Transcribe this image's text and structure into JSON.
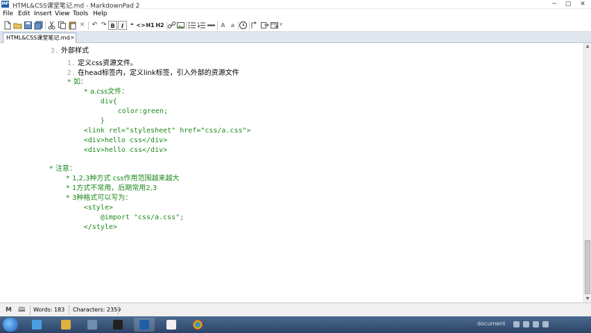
{
  "window": {
    "app_icon_text": "MP",
    "title": "HTML&CSS课堂笔记.md - MarkdownPad 2",
    "min_glyph": "─",
    "max_glyph": "▢",
    "close_glyph": "✕"
  },
  "menu": {
    "items": [
      "File",
      "Edit",
      "Insert",
      "View",
      "Tools",
      "Help"
    ]
  },
  "toolbar": {
    "bold": "B",
    "italic": "I",
    "quote": "❝",
    "code": "<>",
    "h1": "H1",
    "h2": "H2",
    "upper_a": "A",
    "lower_a": "a"
  },
  "tab": {
    "label": "HTML&CSS课堂笔记.md",
    "close": "✕"
  },
  "editor": {
    "lines": [
      {
        "marker": "3.",
        "text": "外部样式",
        "cls": "dark cjk"
      },
      {
        "marker": "1.",
        "text": "定义css资源文件。",
        "cls": "dark cjk"
      },
      {
        "marker": "2.",
        "text": "在head标签内，定义link标签，引入外部的资源文件",
        "cls": "dark cjk"
      },
      {
        "marker": "*",
        "text": "如：",
        "cls": "green cjk"
      },
      {
        "marker": "*",
        "text": "a.css文件：",
        "cls": "green cjk"
      },
      {
        "marker": "",
        "text": "div{",
        "cls": "green mono"
      },
      {
        "marker": "",
        "text": "color:green;",
        "cls": "green mono"
      },
      {
        "marker": "",
        "text": "}",
        "cls": "green mono"
      },
      {
        "marker": "",
        "text": "<link rel=\"stylesheet\" href=\"css/a.css\">",
        "cls": "green mono"
      },
      {
        "marker": "",
        "text": "<div>hello css</div>",
        "cls": "green mono"
      },
      {
        "marker": "",
        "text": "<div>hello css</div>",
        "cls": "green mono"
      },
      {
        "marker": "*",
        "text": "注意：",
        "cls": "green cjk"
      },
      {
        "marker": "*",
        "text": "1,2,3种方式 css作用范围越来越大",
        "cls": "green cjk"
      },
      {
        "marker": "*",
        "text": "1方式不常用，后期常用2,3",
        "cls": "green cjk"
      },
      {
        "marker": "*",
        "text": "3种格式可以写为：",
        "cls": "green cjk"
      },
      {
        "marker": "",
        "text": "<style>",
        "cls": "green mono"
      },
      {
        "marker": "",
        "text": "@import \"css/a.css\";",
        "cls": "green mono"
      },
      {
        "marker": "",
        "text": "</style>",
        "cls": "green mono"
      }
    ]
  },
  "scrollbar": {
    "up": "▲",
    "down": "▼",
    "position": 0.82
  },
  "status": {
    "md_icon": "M",
    "book_icon": "🕮",
    "words": "Words: 183",
    "characters": "Characters: 2359"
  },
  "taskbar": {
    "tray_text": "document"
  }
}
